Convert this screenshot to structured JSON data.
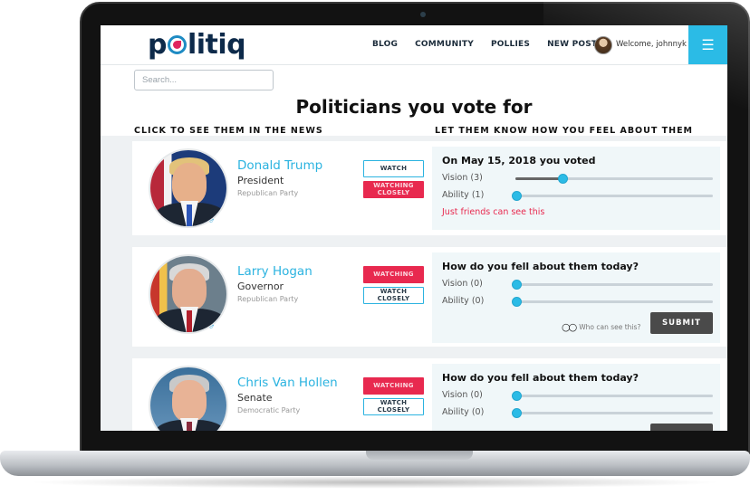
{
  "app": {
    "logo": "politiq",
    "nav": [
      "BLOG",
      "COMMUNITY",
      "POLLIES",
      "NEW POST"
    ],
    "welcome": "Welcome, johnnyk",
    "menu_icon": "hamburger-icon"
  },
  "search": {
    "placeholder": "Search..."
  },
  "page": {
    "title": "Politicians you vote for",
    "left_heading": "CLICK TO SEE THEM IN THE NEWS",
    "right_heading": "LET THEM KNOW HOW YOU FEEL ABOUT THEM"
  },
  "politicians": [
    {
      "name": "Donald Trump",
      "title": "President",
      "party": "Republican Party",
      "gender_icon": "male-symbol-icon",
      "buttons": [
        {
          "label": "WATCH",
          "selected": false
        },
        {
          "label": "WATCHING CLOSELY",
          "selected": true
        }
      ],
      "panel": {
        "heading": "On May 15, 2018 you voted",
        "sliders": [
          {
            "label": "Vision (3)",
            "value": 3
          },
          {
            "label": "Ability (1)",
            "value": 1
          }
        ],
        "note": "Just friends can see this"
      }
    },
    {
      "name": "Larry Hogan",
      "title": "Governor",
      "party": "Republican Party",
      "gender_icon": "male-symbol-icon",
      "buttons": [
        {
          "label": "WATCHING",
          "selected": true
        },
        {
          "label": "WATCH CLOSELY",
          "selected": false
        }
      ],
      "panel": {
        "heading": "How do you fell about them today?",
        "sliders": [
          {
            "label": "Vision (0)",
            "value": 0
          },
          {
            "label": "Ability (0)",
            "value": 0
          }
        ],
        "who_can_see": "Who can see this?",
        "submit": "SUBMIT"
      }
    },
    {
      "name": "Chris Van Hollen",
      "title": "Senate",
      "party": "Democratic Party",
      "buttons": [
        {
          "label": "WATCHING",
          "selected": true
        },
        {
          "label": "WATCH CLOSELY",
          "selected": false
        }
      ],
      "panel": {
        "heading": "How do you fell about them today?",
        "sliders": [
          {
            "label": "Vision (0)",
            "value": 0
          },
          {
            "label": "Ability (0)",
            "value": 0
          }
        ]
      }
    }
  ],
  "colors": {
    "accent": "#2bbbe6",
    "watching_red": "#e8294f",
    "logo_navy": "#0d2a4a"
  }
}
